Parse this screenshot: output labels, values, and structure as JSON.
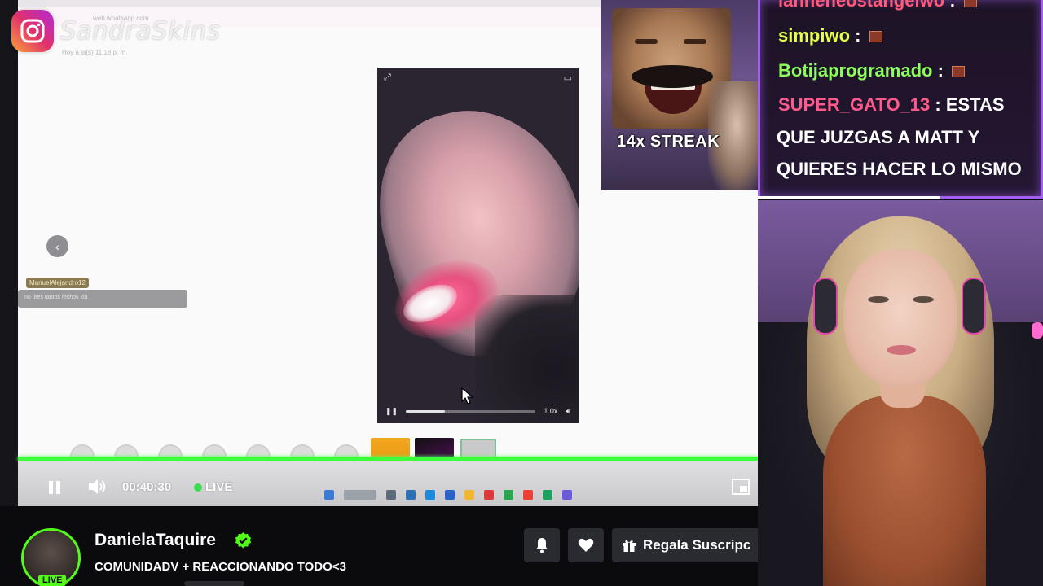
{
  "watermark": {
    "text": "SandraSkins",
    "icon": "instagram-icon"
  },
  "screen": {
    "faint_site": "web.whatsapp.com",
    "faint_time": "Hoy a la(s) 11:18 p. m.",
    "comment_user": "ManuelAlejandro12",
    "comment_text": "no tires tantos fechos kia",
    "phone_speed": "1.0x"
  },
  "player": {
    "time": "00:40:30",
    "live_label": "LIVE",
    "progress": 1.0,
    "accent": "#53fc18"
  },
  "meme": {
    "caption": "14x STREAK"
  },
  "chat": {
    "messages": [
      {
        "user": "lanneneostangelwo",
        "color": "#ff5a7a",
        "text": ""
      },
      {
        "user": "simpiwo",
        "color": "#e6ff4a",
        "text": ""
      },
      {
        "user": "Botijaprogramado",
        "color": "#8cff5a",
        "text": ""
      },
      {
        "user": "SUPER_GATO_13",
        "color": "#ff5a8c",
        "text": "ESTAS"
      }
    ],
    "continuation": [
      "QUE JUZGAS A MATT Y",
      "QUIERES HACER LO MISMO"
    ]
  },
  "channel": {
    "name": "DanielaTaquire",
    "title": "COMUNIDADV + REACCIONANDO TODO<3",
    "live_badge": "LIVE",
    "gift_label": "Regala Suscripc",
    "verified": true
  }
}
